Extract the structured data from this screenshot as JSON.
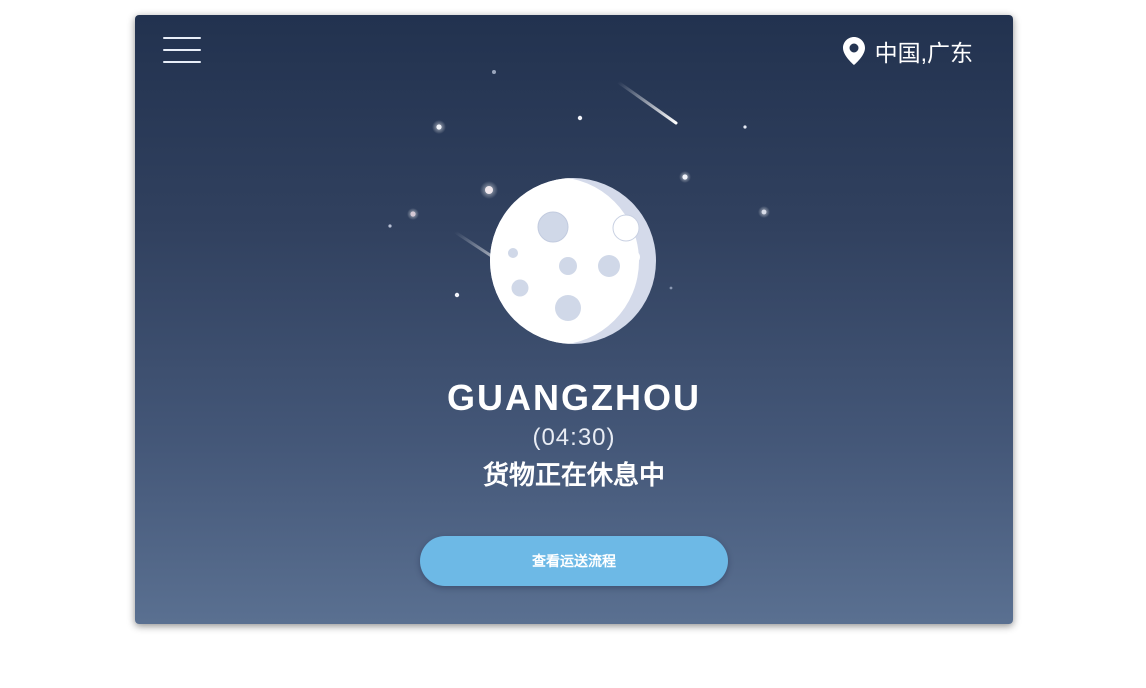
{
  "header": {
    "menu_icon": "hamburger-menu-icon",
    "location_icon": "map-pin-icon",
    "location": "中国,广东"
  },
  "main": {
    "moon_icon": "moon-icon",
    "city": "GUANGZHOU",
    "time": "(04:30)",
    "status": "货物正在休息中",
    "action_button": "查看运送流程"
  },
  "colors": {
    "sky_top": "#22324f",
    "sky_bottom": "#5a7091",
    "button": "#6db9e6",
    "moon": "#ffffff",
    "moon_crater": "#d4daea"
  }
}
